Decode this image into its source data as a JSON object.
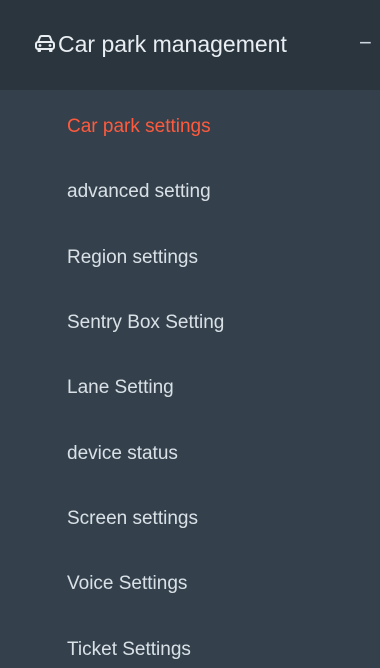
{
  "sidebar": {
    "group": {
      "icon": "car-icon",
      "title": "Car park management",
      "toggle": "−"
    },
    "items": [
      {
        "label": "Car park settings",
        "active": true
      },
      {
        "label": "advanced setting",
        "active": false
      },
      {
        "label": "Region settings",
        "active": false
      },
      {
        "label": "Sentry Box Setting",
        "active": false
      },
      {
        "label": "Lane Setting",
        "active": false
      },
      {
        "label": "device status",
        "active": false
      },
      {
        "label": "Screen settings",
        "active": false
      },
      {
        "label": "Voice Settings",
        "active": false
      },
      {
        "label": "Ticket Settings",
        "active": false
      }
    ]
  },
  "colors": {
    "background": "#34414c",
    "header_background": "#2a353e",
    "active_text": "#ff5a3d",
    "text": "#d9e1e7"
  }
}
